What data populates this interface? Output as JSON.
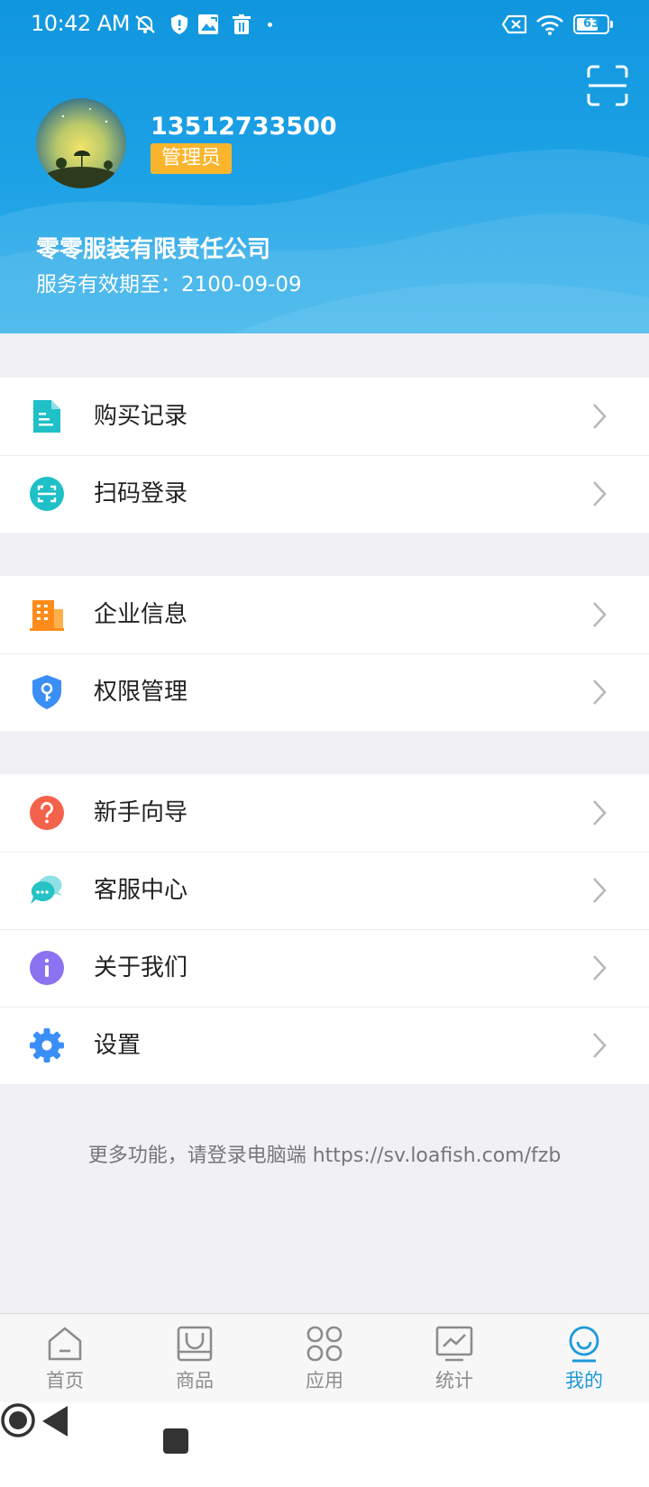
{
  "status_bar": {
    "time": "10:42 AM",
    "battery": "63",
    "icons": [
      "mute-icon",
      "shield-icon",
      "image-icon",
      "trash-icon",
      "dot-icon",
      "sim-x-icon",
      "wifi-icon",
      "battery-icon"
    ]
  },
  "profile": {
    "phone": "13512733500",
    "role": "管理员",
    "company": "零零服装有限责任公司",
    "expiry": "服务有效期至：2100-09-09"
  },
  "menu_groups": [
    {
      "items": [
        {
          "label": "购买记录",
          "icon": "document-icon",
          "color": "#1fc0c7"
        },
        {
          "label": "扫码登录",
          "icon": "scan-icon",
          "color": "#1fc0c7"
        }
      ]
    },
    {
      "items": [
        {
          "label": "企业信息",
          "icon": "building-icon",
          "color": "#ff8c1a"
        },
        {
          "label": "权限管理",
          "icon": "key-shield-icon",
          "color": "#3a8ef6"
        }
      ]
    },
    {
      "items": [
        {
          "label": "新手向导",
          "icon": "question-icon",
          "color": "#f4624b"
        },
        {
          "label": "客服中心",
          "icon": "chat-icon",
          "color": "#25c2c6"
        },
        {
          "label": "关于我们",
          "icon": "info-icon",
          "color": "#8a72f0"
        },
        {
          "label": "设置",
          "icon": "gear-icon",
          "color": "#3a8ef6"
        }
      ]
    }
  ],
  "footer_text": "更多功能，请登录电脑端  https://sv.loafish.com/fzb",
  "tabs": [
    {
      "label": "首页",
      "icon": "home-icon",
      "active": false
    },
    {
      "label": "商品",
      "icon": "inbox-icon",
      "active": false
    },
    {
      "label": "应用",
      "icon": "apps-icon",
      "active": false
    },
    {
      "label": "统计",
      "icon": "chart-icon",
      "active": false
    },
    {
      "label": "我的",
      "icon": "smile-icon",
      "active": true
    }
  ],
  "colors": {
    "header": "#1a9fe4",
    "accent": "#1c9ad9",
    "badge": "#fab52d"
  }
}
